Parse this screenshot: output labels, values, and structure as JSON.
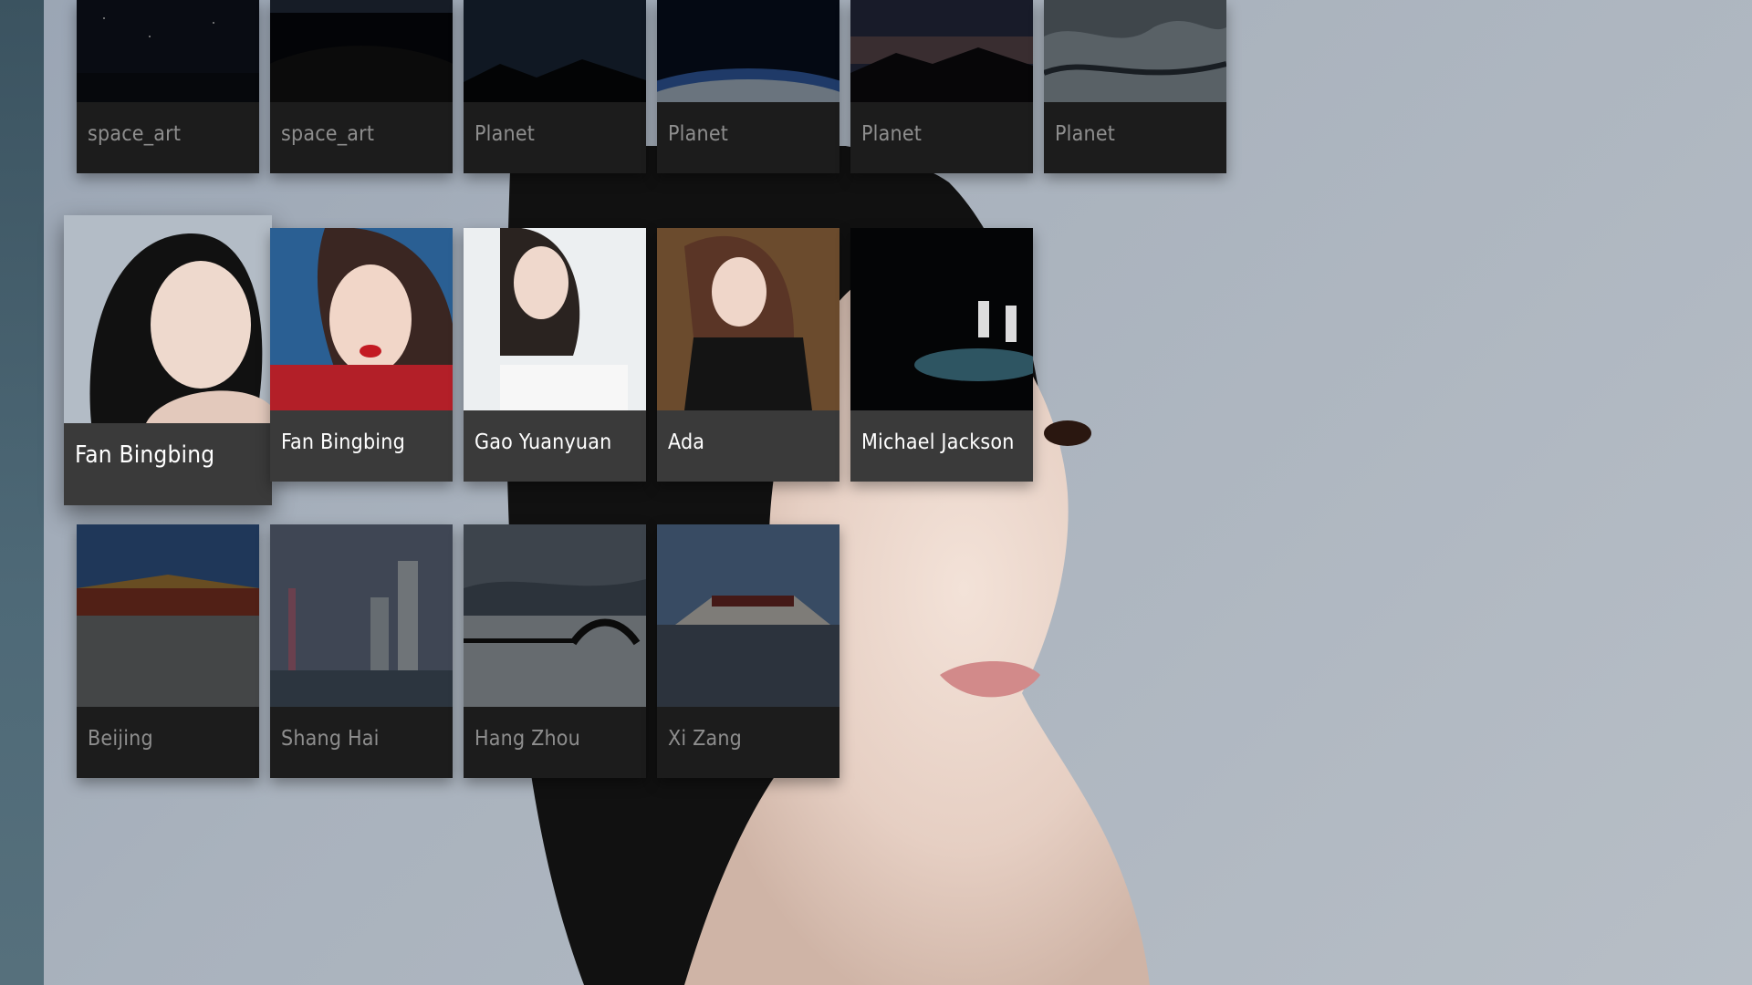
{
  "rows": [
    {
      "items": [
        {
          "label": "space_art",
          "theme": "space-stars"
        },
        {
          "label": "space_art",
          "theme": "earth-night"
        },
        {
          "label": "Planet",
          "theme": "mountain-night"
        },
        {
          "label": "Planet",
          "theme": "earth-glow"
        },
        {
          "label": "Planet",
          "theme": "milkyway-mountain"
        },
        {
          "label": "Planet",
          "theme": "earth-clouds"
        }
      ]
    },
    {
      "items": [
        {
          "label": "Fan Bingbing",
          "theme": "portrait",
          "focused": true
        },
        {
          "label": "Fan Bingbing",
          "theme": "portrait-red"
        },
        {
          "label": "Gao Yuanyuan",
          "theme": "portrait-white"
        },
        {
          "label": "Ada",
          "theme": "portrait-black"
        },
        {
          "label": "Michael Jackson",
          "theme": "stage"
        }
      ]
    },
    {
      "items": [
        {
          "label": "Beijing",
          "theme": "forbidden-city"
        },
        {
          "label": "Shang Hai",
          "theme": "skyline"
        },
        {
          "label": "Hang Zhou",
          "theme": "lake-bridge"
        },
        {
          "label": "Xi Zang",
          "theme": "potala"
        }
      ]
    }
  ],
  "colors": {
    "card_bg": "#1c1c1c",
    "card_caption_active": "#3a3a3a",
    "rail": "#4e6977",
    "background": "#a9b2bd"
  }
}
